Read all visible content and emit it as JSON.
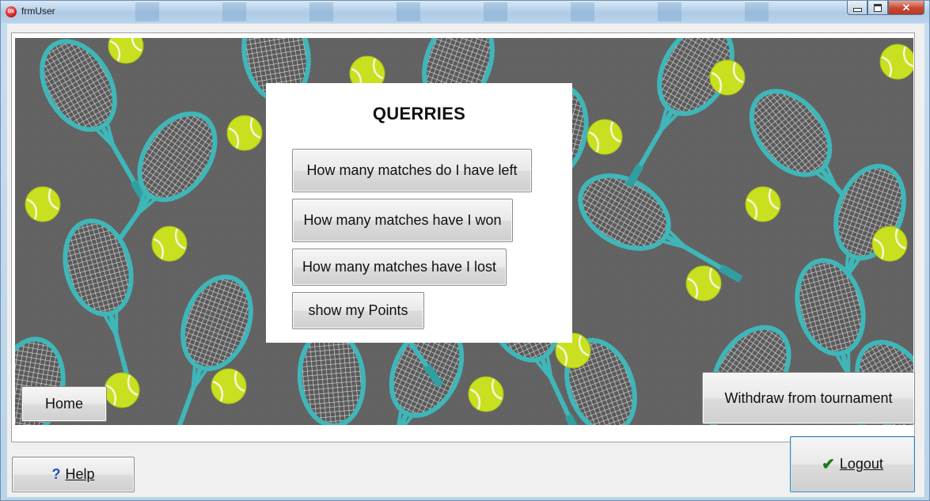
{
  "window": {
    "title": "frmUser"
  },
  "query_panel": {
    "title": "QUERRIES",
    "buttons": [
      "How many matches do I have left",
      "How many matches have I won",
      "How many matches have I lost",
      "show my Points"
    ]
  },
  "nav": {
    "home_label": "Home",
    "withdraw_label": "Withdraw from tournament"
  },
  "footer": {
    "help_label": "Help",
    "logout_label": "Logout"
  },
  "icons": {
    "help": "question-mark-icon",
    "logout": "checkmark-icon",
    "app": "app-logo-icon"
  },
  "colors": {
    "racket": "#3fb6b8",
    "ball": "#c9e020",
    "background_fabric": "#5f5f60"
  }
}
